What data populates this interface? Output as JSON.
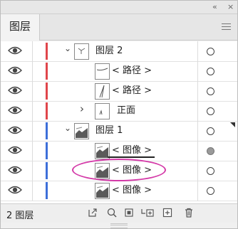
{
  "panel": {
    "tab_label": "图层",
    "footer_count": "2 图层"
  },
  "colors": {
    "layer2": "#e0464b",
    "layer1": "#3d6fd9",
    "annotation": "#d43aa8"
  },
  "rows": [
    {
      "label": "图层 2",
      "kind": "layer",
      "expanded": true,
      "target": "hollow"
    },
    {
      "label": "< 路径 >",
      "kind": "path",
      "target": "hollow"
    },
    {
      "label": "< 路径 >",
      "kind": "path",
      "target": "hollow"
    },
    {
      "label": "正面",
      "kind": "group",
      "expanded": false,
      "target": "hollow"
    },
    {
      "label": "图层 1",
      "kind": "layer",
      "expanded": true,
      "target": "hollow",
      "selected_marker": true
    },
    {
      "label": "< 图像 >",
      "kind": "image",
      "target": "filled",
      "underlined": true
    },
    {
      "label": "< 图像 >",
      "kind": "image",
      "target": "hollow",
      "circled": true
    },
    {
      "label": "< 图像 >",
      "kind": "image",
      "target": "hollow"
    }
  ],
  "icons": {
    "top_collapse": "«",
    "top_close": "×",
    "eye": "eye-icon",
    "chevron_down": "⌄",
    "chevron_right": "›",
    "footer": [
      "export-icon",
      "search-icon",
      "clip-mask-icon",
      "sublayer-icon",
      "new-layer-icon",
      "trash-icon"
    ]
  }
}
